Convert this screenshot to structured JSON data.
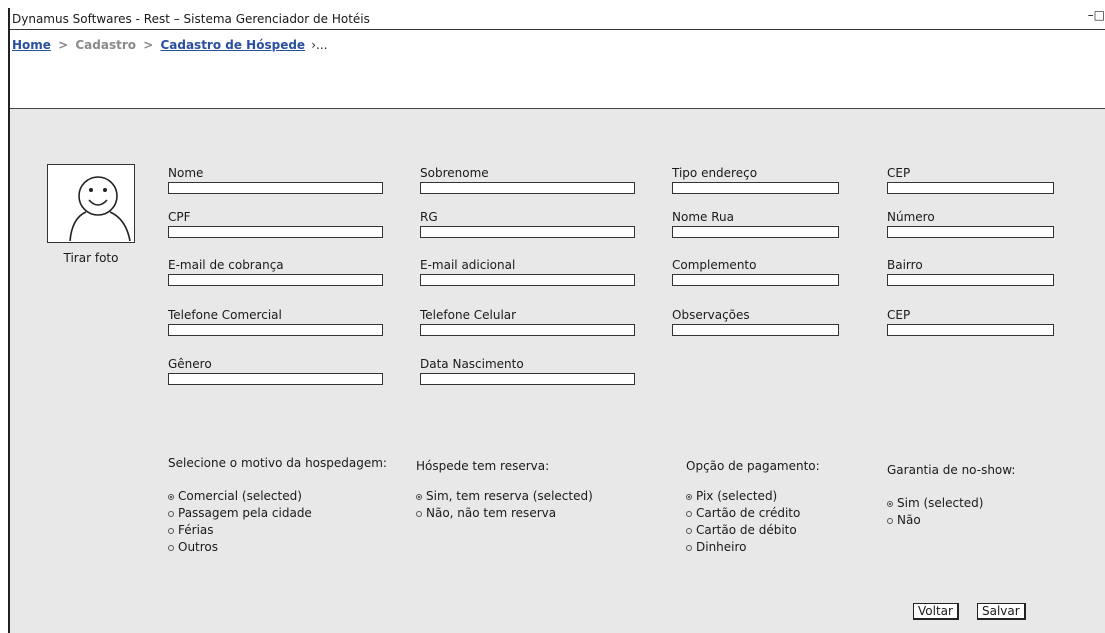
{
  "window": {
    "title": "Dynamus Softwares - Rest – Sistema Gerenciador de Hotéis",
    "controls": "–□"
  },
  "breadcrumb": {
    "home": "Home",
    "cadastro": "Cadastro",
    "current": "Cadastro de Hóspede",
    "tail": "›..."
  },
  "photo": {
    "label": "Tirar foto"
  },
  "fields": {
    "nome": "Nome",
    "sobrenome": "Sobrenome",
    "tipo_endereco": "Tipo endereço",
    "cep1": "CEP",
    "cpf": "CPF",
    "rg": "RG",
    "nome_rua": "Nome Rua",
    "numero": "Número",
    "email_cobranca": "E-mail de cobrança",
    "email_adicional": "E-mail adicional",
    "complemento": "Complemento",
    "bairro": "Bairro",
    "tel_comercial": "Telefone Comercial",
    "tel_celular": "Telefone Celular",
    "observacoes": "Observações",
    "cep2": "CEP",
    "genero": "Gênero",
    "data_nascimento": "Data Nascimento"
  },
  "motivo": {
    "title": "Selecione o motivo da hospedagem:",
    "options": [
      "Comercial (selected)",
      "Passagem pela cidade",
      "Férias",
      "Outros"
    ]
  },
  "reserva": {
    "title": "Hóspede tem reserva:",
    "options": [
      "Sim, tem reserva (selected)",
      "Não, não tem reserva"
    ]
  },
  "pagamento": {
    "title": "Opção de pagamento:",
    "options": [
      "Pix (selected)",
      "Cartão de crédito",
      "Cartão de débito",
      "Dinheiro"
    ]
  },
  "noshow": {
    "title": "Garantia de no-show:",
    "options": [
      "Sim (selected)",
      "Não"
    ]
  },
  "buttons": {
    "voltar": "Voltar",
    "salvar": "Salvar"
  }
}
